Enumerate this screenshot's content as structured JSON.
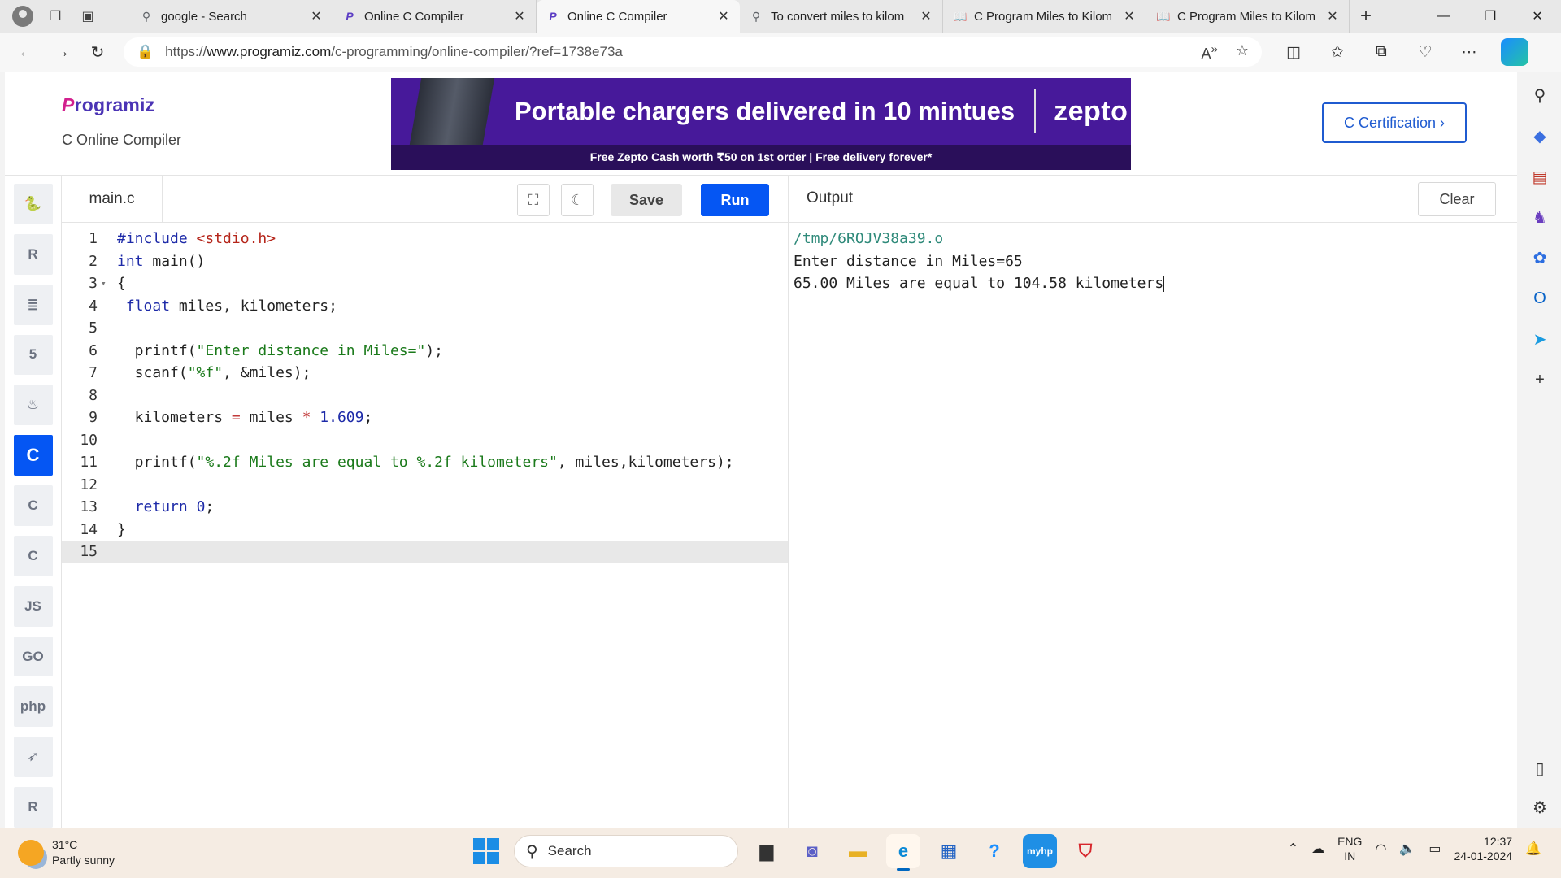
{
  "browser": {
    "tabs": [
      {
        "title": "google - Search",
        "favicon": "search-icon"
      },
      {
        "title": "Online C Compiler",
        "favicon": "programiz-icon"
      },
      {
        "title": "Online C Compiler",
        "favicon": "programiz-icon",
        "active": true
      },
      {
        "title": "To convert miles to kilom",
        "favicon": "search-icon"
      },
      {
        "title": "C Program Miles to Kilom",
        "favicon": "book-icon"
      },
      {
        "title": "C Program Miles to Kilom",
        "favicon": "book-icon"
      }
    ],
    "url_prefix": "https://",
    "url_host": "www.programiz.com",
    "url_path": "/c-programming/online-compiler/?ref=1738e73a"
  },
  "site": {
    "logo": "rogramiz",
    "logo_p": "P",
    "subtitle": "C Online Compiler",
    "certification_button": "C Certification ›",
    "ad": {
      "headline": "Portable chargers delivered in 10 mintues",
      "brand": "zepto",
      "footer": "Free Zepto Cash worth ₹50 on 1st order | Free delivery forever*"
    }
  },
  "languages": [
    {
      "name": "python-icon",
      "glyph": "🐍"
    },
    {
      "name": "r-icon",
      "glyph": "R"
    },
    {
      "name": "sql-icon",
      "glyph": "≣"
    },
    {
      "name": "html-icon",
      "glyph": "5"
    },
    {
      "name": "java-icon",
      "glyph": "♨"
    },
    {
      "name": "c-icon",
      "glyph": "C",
      "active": true
    },
    {
      "name": "cpp-icon",
      "glyph": "C"
    },
    {
      "name": "csharp-icon",
      "glyph": "C"
    },
    {
      "name": "js-icon",
      "glyph": "JS"
    },
    {
      "name": "go-icon",
      "glyph": "GO"
    },
    {
      "name": "php-icon",
      "glyph": "php"
    },
    {
      "name": "swift-icon",
      "glyph": "➶"
    },
    {
      "name": "rust-icon",
      "glyph": "R"
    }
  ],
  "editor": {
    "filename": "main.c",
    "save_label": "Save",
    "run_label": "Run",
    "lines": [
      "#include <stdio.h>",
      "int main()",
      "{",
      " float miles, kilometers;",
      "",
      "  printf(\"Enter distance in Miles=\");",
      "  scanf(\"%f\", &miles);",
      "",
      "  kilometers = miles * 1.609;",
      "",
      "  printf(\"%.2f Miles are equal to %.2f kilometers\", miles,kilometers);",
      "",
      "  return 0;",
      "}",
      ""
    ]
  },
  "output": {
    "title": "Output",
    "clear_label": "Clear",
    "lines": [
      "/tmp/6ROJV38a39.o",
      "Enter distance in Miles=65",
      "65.00 Miles are equal to 104.58 kilometers"
    ]
  },
  "taskbar": {
    "temperature": "31°C",
    "weather": "Partly sunny",
    "search_placeholder": "Search",
    "lang_top": "ENG",
    "lang_bottom": "IN",
    "time": "12:37",
    "date": "24-01-2024"
  }
}
